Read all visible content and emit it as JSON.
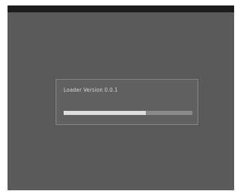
{
  "loader": {
    "version_label": "Loader Version  0.0.1",
    "progress_fraction": 0.64
  },
  "colors": {
    "screen_background": "#5a5a5a",
    "top_bar": "#1c1c1c",
    "progress_fill": "#dedede",
    "progress_track": "#8a8a8a"
  }
}
